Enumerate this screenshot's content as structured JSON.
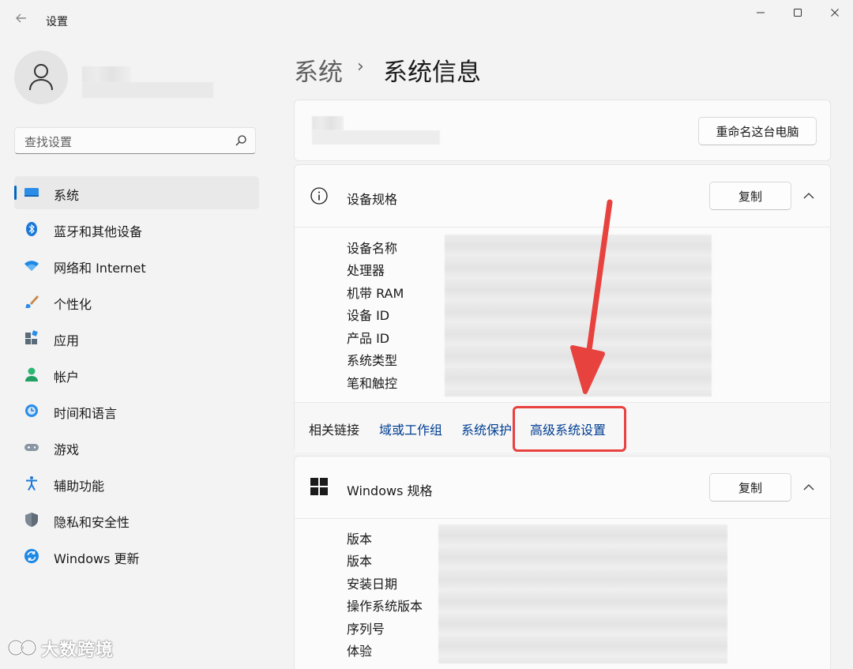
{
  "window": {
    "title": "设置"
  },
  "search": {
    "placeholder": "查找设置"
  },
  "nav": {
    "items": [
      {
        "label": "系统",
        "icon": "system-icon",
        "active": true
      },
      {
        "label": "蓝牙和其他设备",
        "icon": "bluetooth-icon"
      },
      {
        "label": "网络和 Internet",
        "icon": "wifi-icon"
      },
      {
        "label": "个性化",
        "icon": "brush-icon"
      },
      {
        "label": "应用",
        "icon": "apps-icon"
      },
      {
        "label": "帐户",
        "icon": "account-icon"
      },
      {
        "label": "时间和语言",
        "icon": "time-language-icon"
      },
      {
        "label": "游戏",
        "icon": "gamepad-icon"
      },
      {
        "label": "辅助功能",
        "icon": "accessibility-icon"
      },
      {
        "label": "隐私和安全性",
        "icon": "shield-icon"
      },
      {
        "label": "Windows 更新",
        "icon": "update-icon"
      }
    ]
  },
  "breadcrumb": {
    "parent": "系统",
    "separator": "›",
    "current": "系统信息"
  },
  "pc_card": {
    "rename_button": "重命名这台电脑"
  },
  "device_specs": {
    "title": "设备规格",
    "copy_button": "复制",
    "labels": [
      "设备名称",
      "处理器",
      "机带 RAM",
      "设备 ID",
      "产品 ID",
      "系统类型",
      "笔和触控"
    ]
  },
  "related_links": {
    "label": "相关链接",
    "links": [
      "域或工作组",
      "系统保护",
      "高级系统设置"
    ]
  },
  "windows_specs": {
    "title": "Windows 规格",
    "copy_button": "复制",
    "labels": [
      "版本",
      "版本",
      "安装日期",
      "操作系统版本",
      "序列号",
      "体验"
    ]
  },
  "watermark": {
    "text": "大数跨境"
  },
  "colors": {
    "accent": "#0067c0",
    "link": "#003e92",
    "annotation": "#e8423f"
  }
}
